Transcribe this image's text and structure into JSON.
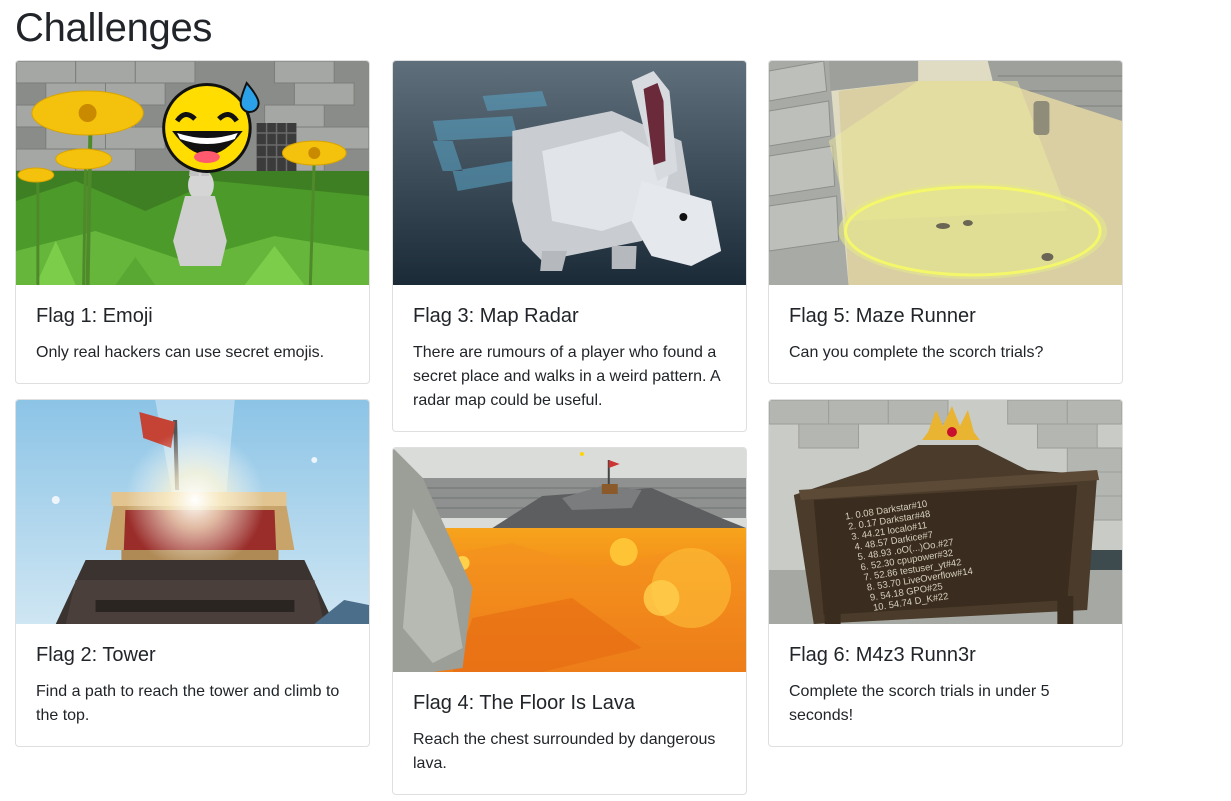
{
  "page": {
    "title": "Challenges"
  },
  "cards": [
    {
      "title": "Flag 1: Emoji",
      "description": "Only real hackers can use secret emojis."
    },
    {
      "title": "Flag 2: Tower",
      "description": "Find a path to reach the tower and climb to the top."
    },
    {
      "title": "Flag 3: Map Radar",
      "description": "There are rumours of a player who found a secret place and walks in a weird pattern. A radar map could be useful."
    },
    {
      "title": "Flag 4: The Floor Is Lava",
      "description": "Reach the chest surrounded by dangerous lava."
    },
    {
      "title": "Flag 5: Maze Runner",
      "description": "Can you complete the scorch trials?"
    },
    {
      "title": "Flag 6: M4z3 Runn3r",
      "description": "Complete the scorch trials in under 5 seconds!"
    }
  ],
  "leaderboard": [
    "1. 0.08 Darkstar#10",
    "2. 0.17 Darkstar#48",
    "3. 44.21 localo#11",
    "4. 48.57 Darkice#7",
    "5. 48.93 .oO(...)Oo.#27",
    "6. 52.30 cpupower#32",
    "7. 52.86 testuser_yt#42",
    "8. 53.70 LiveOverflow#14",
    "9. 54.18 GPO#25",
    "10. 54.74 D_K#22"
  ]
}
